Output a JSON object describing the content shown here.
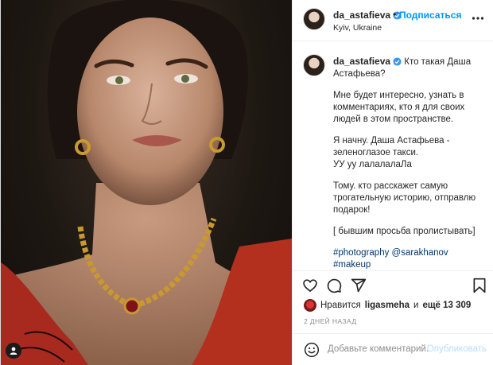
{
  "post": {
    "username": "da_astafieva",
    "follow_label": "Подписаться",
    "separator": "•",
    "location": "Kyiv, Ukraine"
  },
  "caption": {
    "username": "da_astafieva",
    "paragraphs": [
      "Кто такая Даша Астафьева?",
      "Мне будет интересно, узнать в комментариях, кто я для своих людей в этом пространстве.",
      "Я начну. Даша Астафьева - зеленоглазое такси.\nУУ уу лалалалаЛа",
      "Тому. кто расскажет самую трогательную историю, отправлю подарок!",
      "[ бывшим просьба пролистывать]"
    ],
    "hashtag1": "#photography",
    "mention": "@sarakhanov",
    "hashtag2": "#makeup"
  },
  "likes": {
    "prefix": "Нравится",
    "user": "ligasmeha",
    "middle": "и",
    "count": "ещё 13 309"
  },
  "timestamp": "2 ДНЕЙ НАЗАД",
  "comment": {
    "placeholder": "Добавьте комментарий...",
    "publish_label": "Опубликовать"
  },
  "icons": {
    "like": "heart-icon",
    "comment": "comment-icon",
    "share": "share-icon",
    "save": "bookmark-icon",
    "more": "more-icon",
    "emoji": "smiley-icon",
    "verified": "verified-badge-icon",
    "photo_tag": "person-tag-icon"
  },
  "colors": {
    "accent": "#0095f6",
    "link": "#00376b",
    "muted": "#8e8e8e",
    "publish_disabled": "#b2dffc"
  }
}
